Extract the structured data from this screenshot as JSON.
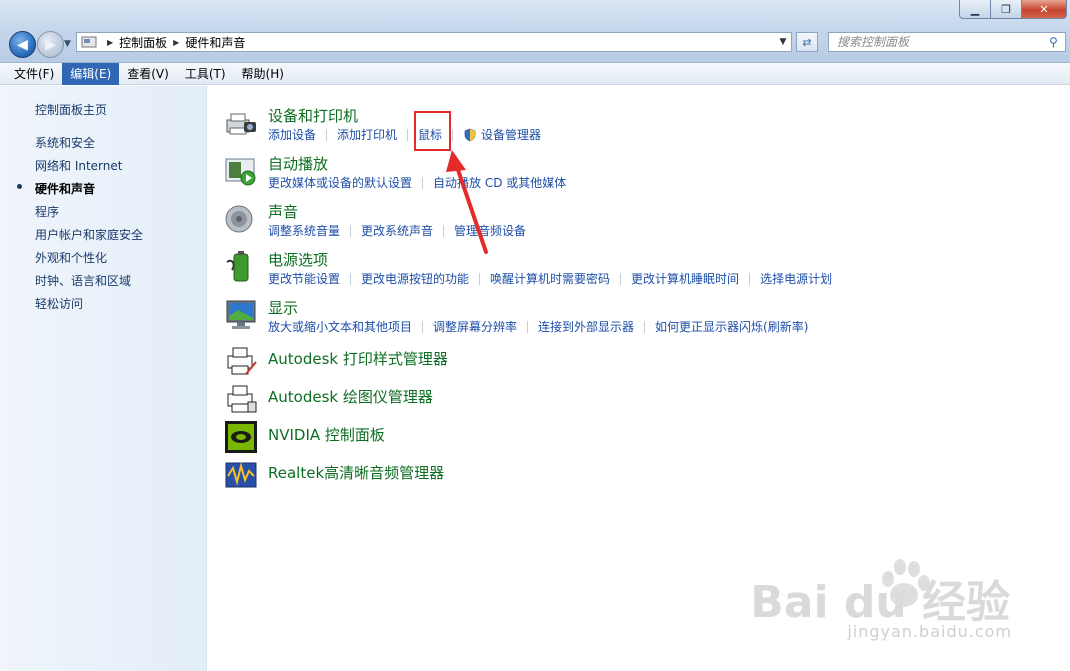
{
  "window": {
    "controls": {
      "minimize": "▁",
      "maximize": "❐",
      "close": "✕"
    }
  },
  "address_bar": {
    "breadcrumbs": [
      "控制面板",
      "硬件和声音"
    ],
    "search_placeholder": "搜索控制面板"
  },
  "menu": [
    {
      "label": "文件(F)",
      "active": false
    },
    {
      "label": "编辑(E)",
      "active": true
    },
    {
      "label": "查看(V)",
      "active": false
    },
    {
      "label": "工具(T)",
      "active": false
    },
    {
      "label": "帮助(H)",
      "active": false
    }
  ],
  "sidebar": {
    "items": [
      {
        "label": "控制面板主页"
      },
      {
        "label": "系统和安全"
      },
      {
        "label": "网络和 Internet"
      },
      {
        "label": "硬件和声音",
        "current": true
      },
      {
        "label": "程序"
      },
      {
        "label": "用户帐户和家庭安全"
      },
      {
        "label": "外观和个性化"
      },
      {
        "label": "时钟、语言和区域"
      },
      {
        "label": "轻松访问"
      }
    ]
  },
  "categories": [
    {
      "title": "设备和打印机",
      "icon": "printer-camera-icon",
      "links": [
        "添加设备",
        "添加打印机",
        "鼠标",
        "设备管理器"
      ]
    },
    {
      "title": "自动播放",
      "icon": "autoplay-icon",
      "links": [
        "更改媒体或设备的默认设置",
        "自动播放 CD 或其他媒体"
      ]
    },
    {
      "title": "声音",
      "icon": "speaker-icon",
      "links": [
        "调整系统音量",
        "更改系统声音",
        "管理音频设备"
      ]
    },
    {
      "title": "电源选项",
      "icon": "battery-power-icon",
      "links": [
        "更改节能设置",
        "更改电源按钮的功能",
        "唤醒计算机时需要密码",
        "更改计算机睡眠时间",
        "选择电源计划"
      ]
    },
    {
      "title": "显示",
      "icon": "monitor-icon",
      "links": [
        "放大或缩小文本和其他项目",
        "调整屏幕分辨率",
        "连接到外部显示器",
        "如何更正显示器闪烁(刷新率)"
      ]
    }
  ],
  "extra_items": [
    {
      "title": "Autodesk 打印样式管理器",
      "icon": "autodesk-plot-style-icon"
    },
    {
      "title": "Autodesk 绘图仪管理器",
      "icon": "autodesk-plotter-icon"
    },
    {
      "title": "NVIDIA 控制面板",
      "icon": "nvidia-icon"
    },
    {
      "title": "Realtek高清晰音频管理器",
      "icon": "realtek-audio-icon"
    }
  ],
  "watermark": {
    "brand": "Bai du 经验",
    "url": "jingyan.baidu.com"
  },
  "colors": {
    "category_title": "#0d6e22",
    "link": "#1e4ea8",
    "highlight_box": "#e42b2b",
    "menu_active": "#2f67b5"
  }
}
